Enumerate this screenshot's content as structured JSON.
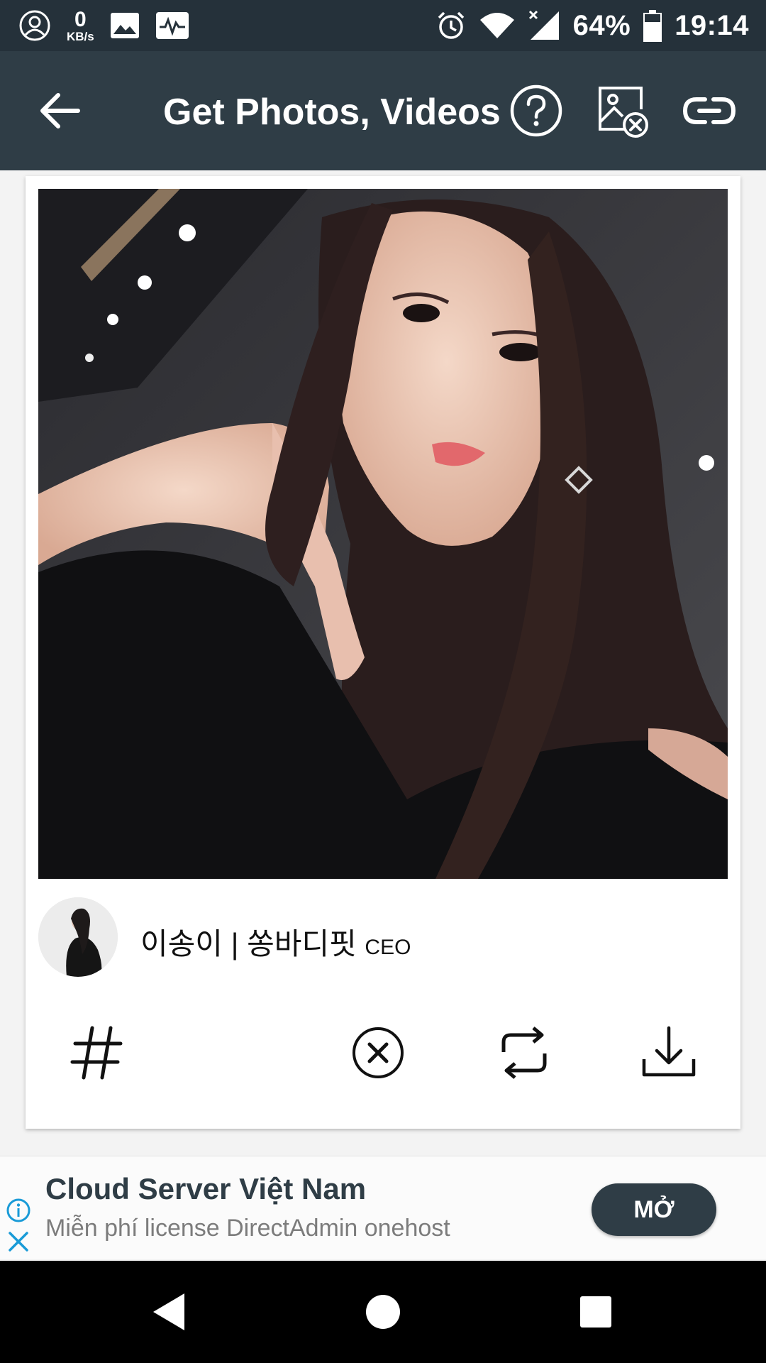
{
  "status_bar": {
    "speed_value": "0",
    "speed_unit": "KB/s",
    "battery_percent": "64%",
    "time": "19:14",
    "icons": [
      "account-circle-icon",
      "gallery-icon",
      "activity-icon",
      "alarm-icon",
      "wifi-icon",
      "signal-icon",
      "battery-icon"
    ]
  },
  "app_bar": {
    "title": "Get Photos, Videos",
    "icons": [
      "back-arrow-icon",
      "help-icon",
      "remove-image-icon",
      "link-icon"
    ]
  },
  "post": {
    "username": "이송이 | 쏭바디핏",
    "username_tag": "CEO",
    "actions": [
      "hashtag-icon",
      "remove-icon",
      "repost-icon",
      "download-icon"
    ]
  },
  "ad": {
    "title": "Cloud Server Việt Nam",
    "subtitle": "Miễn phí license DirectAdmin onehost",
    "button": "MỞ",
    "accent_color": "#1a9bd7"
  },
  "nav_bar": {
    "icons": [
      "back-triangle-icon",
      "home-circle-icon",
      "recents-square-icon"
    ]
  },
  "colors": {
    "status_bar_bg": "#25313a",
    "app_bar_bg": "#2f3d46",
    "card_bg": "#ffffff",
    "page_bg": "#f3f3f3"
  }
}
